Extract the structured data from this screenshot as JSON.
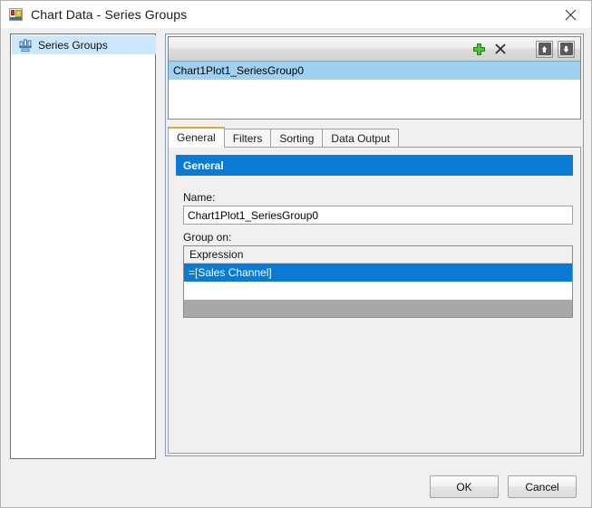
{
  "window": {
    "title": "Chart Data - Series Groups",
    "title_icon": "report-chart-icon",
    "close_icon": "close-icon"
  },
  "sidebar": {
    "items": [
      {
        "label": "Series Groups",
        "icon": "bar-chart-icon",
        "selected": true
      }
    ]
  },
  "list_toolbar": {
    "add_icon": "plus-icon",
    "delete_icon": "x-delete-icon",
    "move_up_icon": "arrow-up-icon",
    "move_down_icon": "arrow-down-icon"
  },
  "group_list": {
    "items": [
      {
        "label": "Chart1Plot1_SeriesGroup0",
        "selected": true
      }
    ]
  },
  "tabs": [
    {
      "label": "General",
      "active": true
    },
    {
      "label": "Filters",
      "active": false
    },
    {
      "label": "Sorting",
      "active": false
    },
    {
      "label": "Data Output",
      "active": false
    }
  ],
  "general": {
    "section_title": "General",
    "name_label": "Name:",
    "name_value": "Chart1Plot1_SeriesGroup0",
    "group_on_label": "Group on:",
    "grid": {
      "columns": [
        "Expression"
      ],
      "rows": [
        {
          "expression": "=[Sales Channel]",
          "selected": true
        },
        {
          "expression": "",
          "selected": false
        }
      ]
    }
  },
  "footer": {
    "ok_label": "OK",
    "cancel_label": "Cancel"
  },
  "colors": {
    "accent_blue": "#0b7ad4",
    "selection_light_blue": "#9fd2f2",
    "tree_selection": "#cce8ff",
    "active_tab_top": "#e8a33d",
    "grid_filler_gray": "#a8a8a8",
    "dialog_background": "#f0f0f0"
  }
}
